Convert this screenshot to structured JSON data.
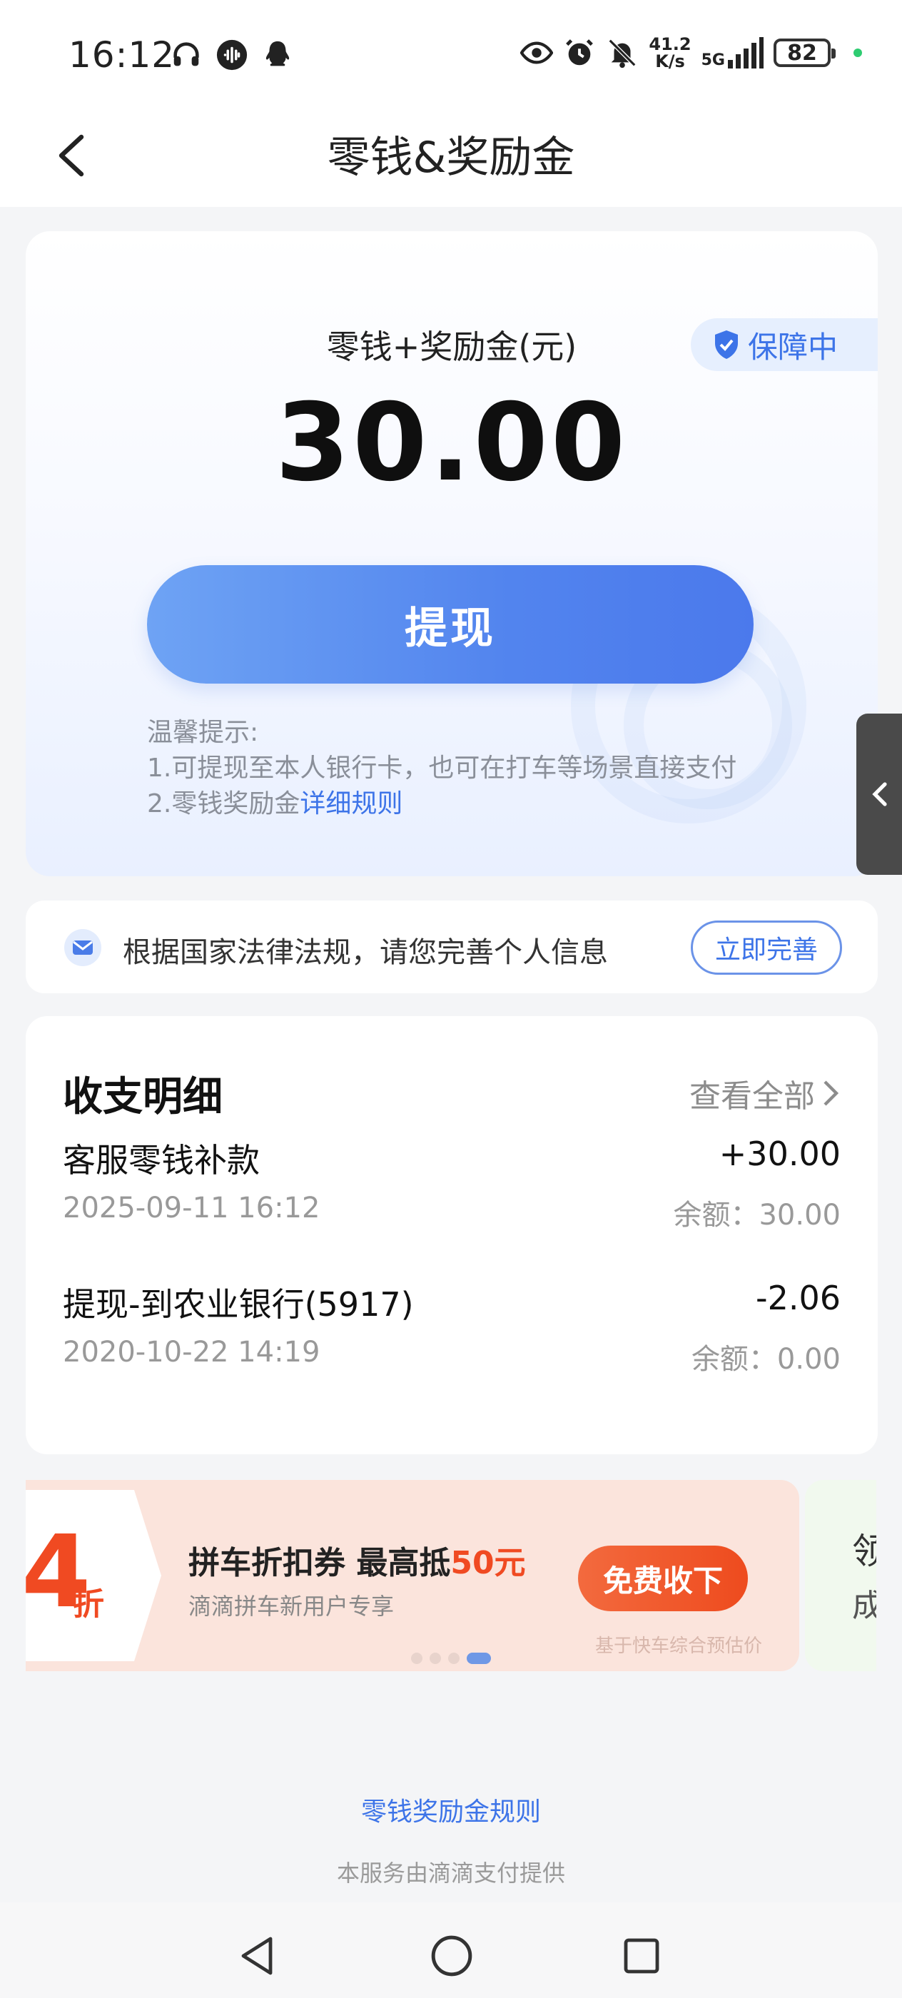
{
  "status_bar": {
    "time": "16:12",
    "net_speed_value": "41.2",
    "net_speed_unit": "K/s",
    "network": "5G",
    "battery": "82"
  },
  "header": {
    "title": "零钱&奖励金"
  },
  "balance": {
    "label": "零钱+奖励金(元)",
    "amount": "30.00",
    "guarantee": "保障中",
    "withdraw_label": "提现",
    "tips_title": "温馨提示:",
    "tip1": "1.可提现至本人银行卡，也可在打车等场景直接支付",
    "tip2_prefix": "2.零钱奖励金",
    "tip2_link": "详细规则"
  },
  "notice": {
    "text": "根据国家法律法规，请您完善个人信息",
    "button": "立即完善"
  },
  "transactions": {
    "title": "收支明细",
    "view_all": "查看全部",
    "rows": [
      {
        "name": "客服零钱补款",
        "time": "2025-09-11 16:12",
        "amount": "+30.00",
        "balance": "余额：30.00"
      },
      {
        "name": "提现-到农业银行(5917)",
        "time": "2020-10-22 14:19",
        "amount": "-2.06",
        "balance": "余额：0.00"
      }
    ]
  },
  "promo": {
    "discount_number": "4",
    "discount_unit": "折",
    "title_prefix": "拼车折扣券 最高抵",
    "title_highlight": "50元",
    "subtitle": "滴滴拼车新用户专享",
    "button": "免费收下",
    "note": "基于快车综合预估价",
    "next_line1": "领",
    "next_line2": "成",
    "dots_total": 4,
    "dot_active": 4
  },
  "footer": {
    "rules_link": "零钱奖励金规则",
    "provider": "本服务由滴滴支付提供"
  },
  "colors": {
    "accent": "#3d74e8",
    "promo_red": "#f04a22"
  }
}
